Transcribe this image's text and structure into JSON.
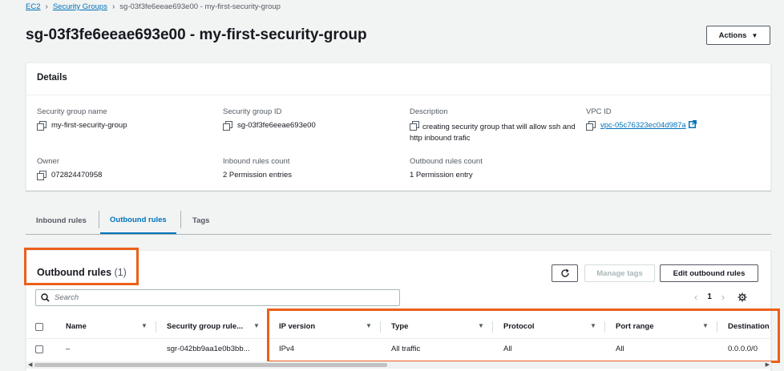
{
  "breadcrumb": {
    "ec2": "EC2",
    "security_groups": "Security Groups",
    "current": "sg-03f3fe6eeae693e00 - my-first-security-group"
  },
  "title": "sg-03f3fe6eeae693e00 - my-first-security-group",
  "actions_label": "Actions",
  "details": {
    "heading": "Details",
    "sg_name_label": "Security group name",
    "sg_name": "my-first-security-group",
    "sg_id_label": "Security group ID",
    "sg_id": "sg-03f3fe6eeae693e00",
    "description_label": "Description",
    "description": "creating security group that will allow ssh and http inbound trafic",
    "vpc_label": "VPC ID",
    "vpc_id": "vpc-05c76323ec04d987a",
    "owner_label": "Owner",
    "owner": "072824470958",
    "inbound_count_label": "Inbound rules count",
    "inbound_count": "2 Permission entries",
    "outbound_count_label": "Outbound rules count",
    "outbound_count": "1 Permission entry"
  },
  "tabs": [
    "Inbound rules",
    "Outbound rules",
    "Tags"
  ],
  "outbound": {
    "title": "Outbound rules",
    "count": "(1)",
    "manage_tags": "Manage tags",
    "edit": "Edit outbound rules",
    "search_placeholder": "Search",
    "page": "1",
    "columns": [
      "Name",
      "Security group rule...",
      "IP version",
      "Type",
      "Protocol",
      "Port range",
      "Destination"
    ],
    "rows": [
      {
        "name": "–",
        "rule_id": "sgr-042bb9aa1e0b3bb...",
        "ip_version": "IPv4",
        "type": "All traffic",
        "protocol": "All",
        "port_range": "All",
        "destination": "0.0.0.0/0"
      }
    ]
  },
  "colors": {
    "accent": "#0073bb",
    "highlight": "#ec5f1a"
  }
}
